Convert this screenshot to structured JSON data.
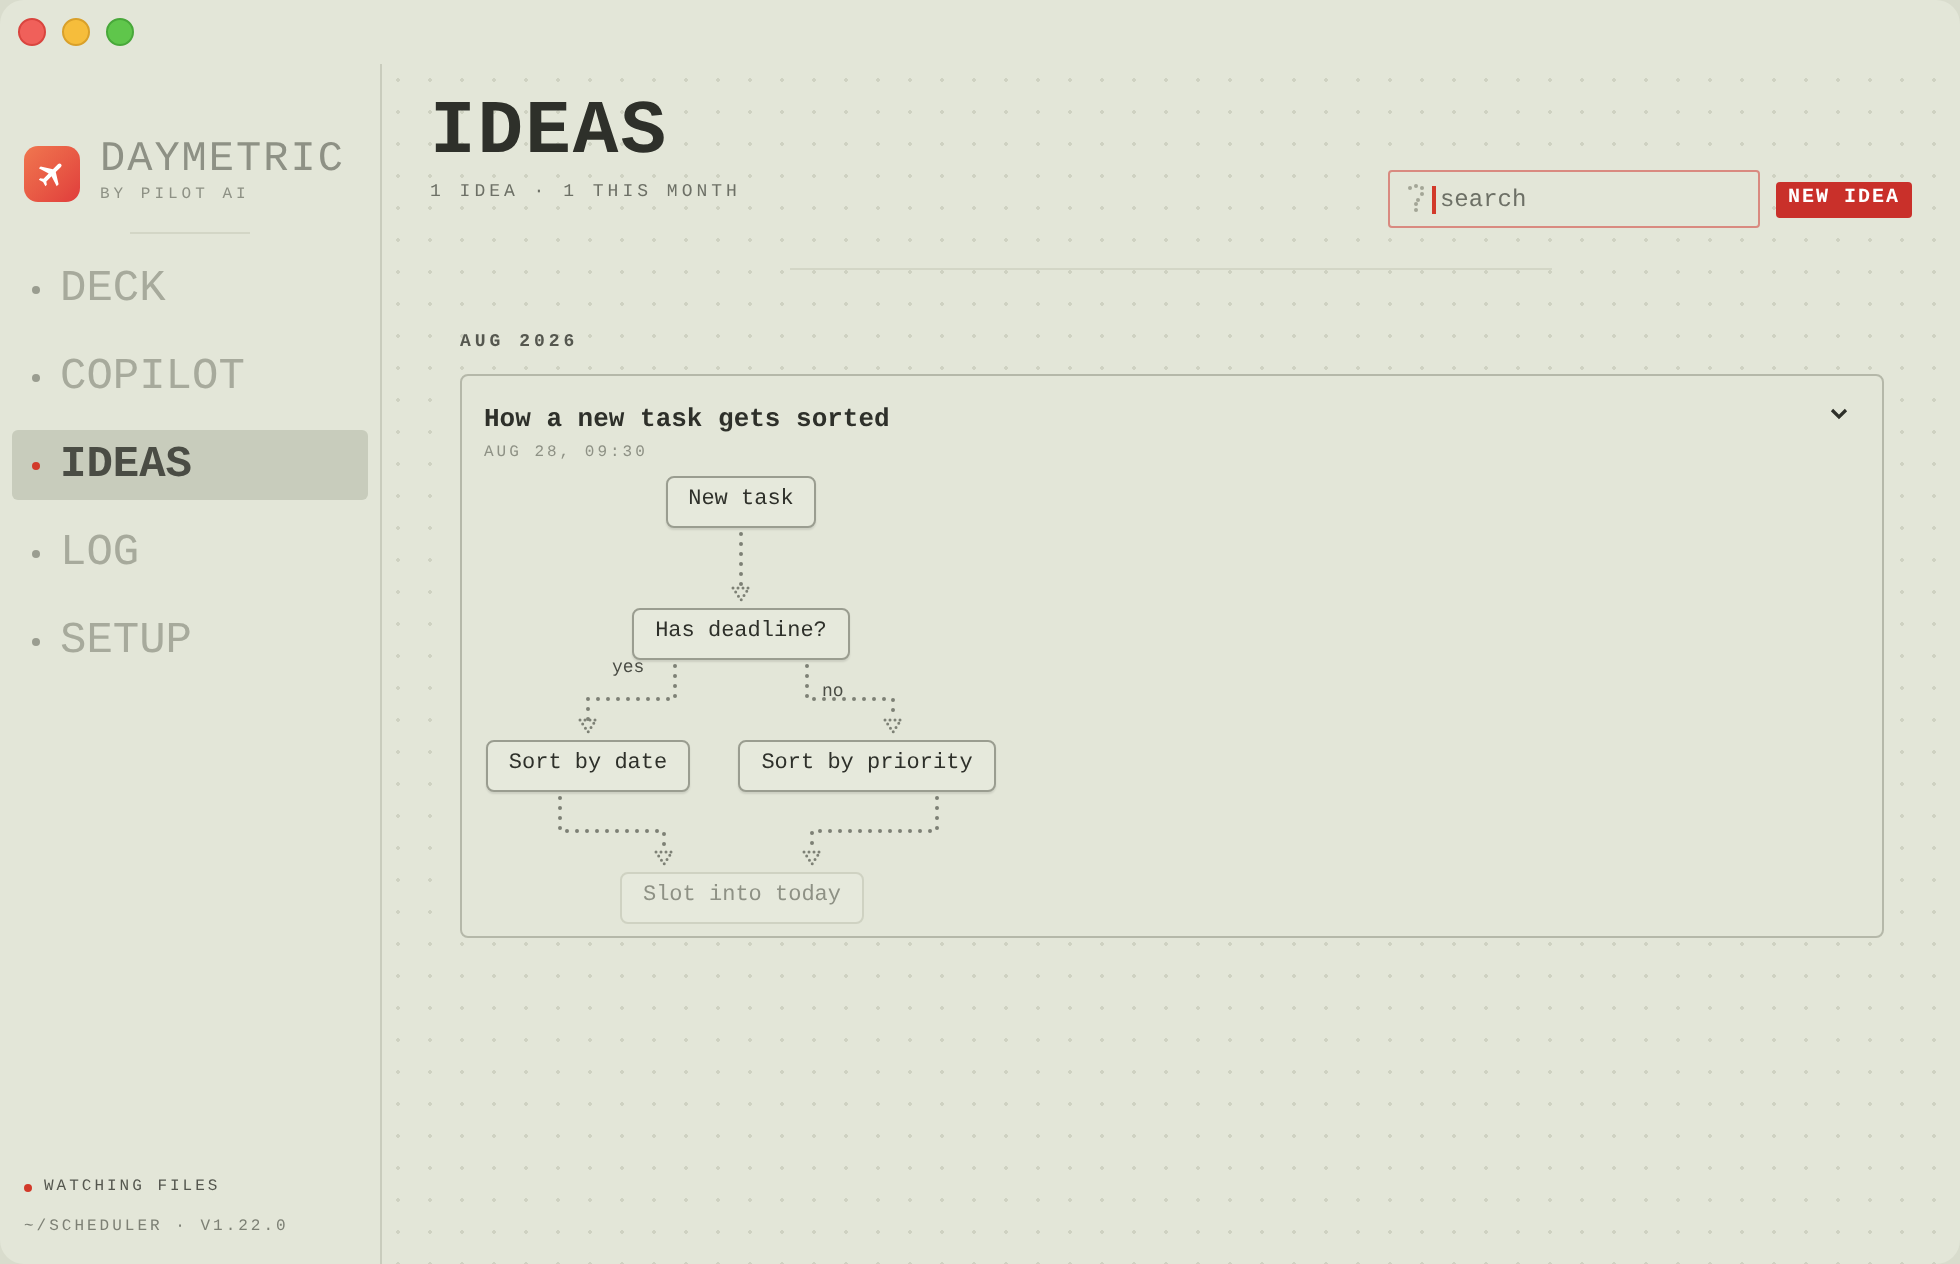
{
  "brand": {
    "name": "DAYMETRIC",
    "tagline": "BY PILOT AI"
  },
  "nav": [
    {
      "label": "DECK",
      "selected": false
    },
    {
      "label": "COPILOT",
      "selected": false
    },
    {
      "label": "IDEAS",
      "selected": true
    },
    {
      "label": "LOG",
      "selected": false
    },
    {
      "label": "SETUP",
      "selected": false
    }
  ],
  "status": {
    "label": "WATCHING FILES",
    "on": true,
    "path": "~/SCHEDULER · V1.22.0"
  },
  "page": {
    "title": "IDEAS",
    "subtitle": "1 IDEA · 1 THIS MONTH"
  },
  "search": {
    "placeholder": "search"
  },
  "new_button": "NEW IDEA",
  "groups": [
    {
      "month": "AUG 2026",
      "ideas": [
        {
          "title": "How a new task gets sorted",
          "date": "AUG 28, 09:30",
          "expanded": true,
          "nodes": [
            {
              "label": "New task",
              "faded": false
            },
            {
              "label": "Has deadline?",
              "faded": false
            },
            {
              "label": "Sort by date",
              "faded": false
            },
            {
              "label": "Sort by priority",
              "faded": false
            },
            {
              "label": "Slot into today",
              "faded": true
            }
          ],
          "edge_labels": [
            "yes",
            "no"
          ]
        }
      ]
    }
  ]
}
